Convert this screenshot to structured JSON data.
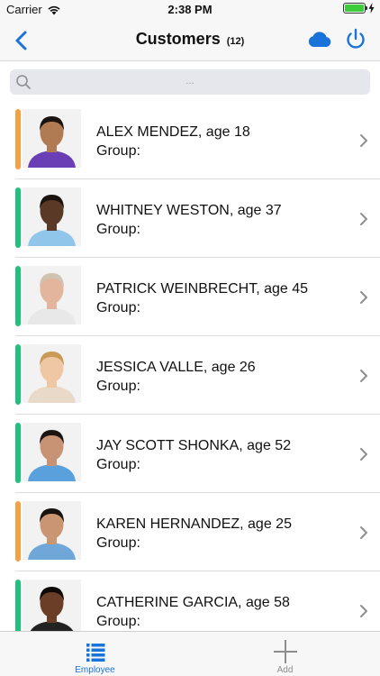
{
  "status_bar": {
    "carrier": "Carrier",
    "time": "2:38 PM",
    "battery_level": 1.0,
    "battery_color": "#3ccd3c"
  },
  "nav": {
    "title": "Customers",
    "count": "(12)",
    "accent_color": "#1a73d8",
    "icons": {
      "back": "chevron-left-icon",
      "cloud": "cloud-icon",
      "power": "power-icon"
    }
  },
  "search": {
    "placeholder": "...",
    "icon": "search-icon"
  },
  "customers": [
    {
      "name": "ALEX MENDEZ, age 18",
      "group": "Group:",
      "status_color": "#f6a044",
      "skin": "#b07a52",
      "hair": "#1c1410",
      "shirt": "#6a3fb5"
    },
    {
      "name": "WHITNEY WESTON, age 37",
      "group": "Group:",
      "status_color": "#1ec27a",
      "skin": "#5a3a26",
      "hair": "#1a120c",
      "shirt": "#8fc6ea"
    },
    {
      "name": "PATRICK WEINBRECHT, age 45",
      "group": "Group:",
      "status_color": "#1ec27a",
      "skin": "#e2b59c",
      "hair": "#cfc3b2",
      "shirt": "#e8e8e8"
    },
    {
      "name": "JESSICA VALLE, age 26",
      "group": "Group:",
      "status_color": "#1ec27a",
      "skin": "#f0c7a5",
      "hair": "#c89a55",
      "shirt": "#e8d9c8"
    },
    {
      "name": "JAY SCOTT SHONKA, age 52",
      "group": "Group:",
      "status_color": "#1ec27a",
      "skin": "#c89274",
      "hair": "#1c1410",
      "shirt": "#5aa0dc"
    },
    {
      "name": "KAREN HERNANDEZ, age 25",
      "group": "Group:",
      "status_color": "#f6a044",
      "skin": "#c99572",
      "hair": "#1a120c",
      "shirt": "#6fa8d8"
    },
    {
      "name": "CATHERINE GARCIA, age 58",
      "group": "Group:",
      "status_color": "#1ec27a",
      "skin": "#6a3e27",
      "hair": "#0f0a08",
      "shirt": "#222222"
    }
  ],
  "tabs": [
    {
      "label": "Employee",
      "icon": "list-icon",
      "active": true
    },
    {
      "label": "Add",
      "icon": "plus-icon",
      "active": false
    }
  ]
}
